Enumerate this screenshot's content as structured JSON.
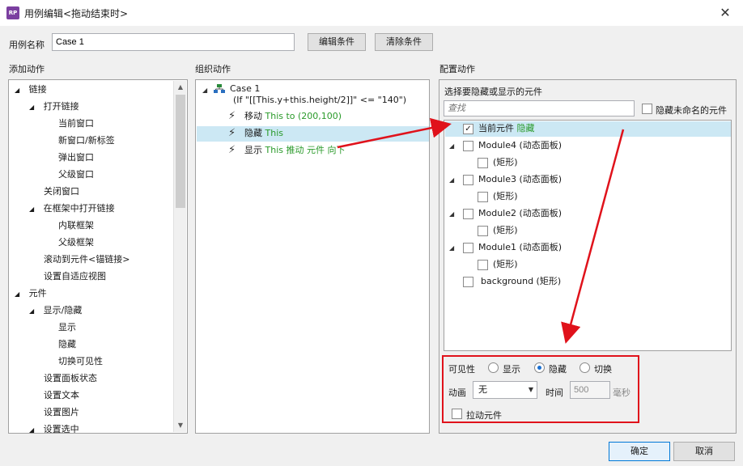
{
  "window": {
    "title": "用例编辑<拖动结束时>",
    "app_icon": "RP"
  },
  "case_name": {
    "label": "用例名称",
    "value": "Case 1",
    "edit_button": "编辑条件",
    "clear_button": "清除条件"
  },
  "add_actions": {
    "header": "添加动作",
    "items": [
      {
        "label": "链接",
        "caret": "◢"
      },
      {
        "label": "打开链接",
        "caret": "◢"
      },
      {
        "label": "当前窗口"
      },
      {
        "label": "新窗口/新标签"
      },
      {
        "label": "弹出窗口"
      },
      {
        "label": "父级窗口"
      },
      {
        "label": "关闭窗口"
      },
      {
        "label": "在框架中打开链接",
        "caret": "◢"
      },
      {
        "label": "内联框架"
      },
      {
        "label": "父级框架"
      },
      {
        "label": "滚动到元件<锚链接>"
      },
      {
        "label": "设置自适应视图"
      },
      {
        "label": "元件",
        "caret": "◢"
      },
      {
        "label": "显示/隐藏",
        "caret": "◢"
      },
      {
        "label": "显示"
      },
      {
        "label": "隐藏"
      },
      {
        "label": "切换可见性"
      },
      {
        "label": "设置面板状态"
      },
      {
        "label": "设置文本"
      },
      {
        "label": "设置图片"
      },
      {
        "label": "设置选中",
        "caret": "◢"
      }
    ]
  },
  "organize": {
    "header": "组织动作",
    "case_title": "Case 1",
    "case_condition": "(If \"[[This.y+this.height/2]]\" <= \"140\")",
    "actions": [
      {
        "verb": "移动",
        "detail": "This to (200,100)"
      },
      {
        "verb": "隐藏",
        "detail": "This"
      },
      {
        "verb": "显示",
        "detail": "This 推动 元件 向下"
      }
    ]
  },
  "configure": {
    "header": "配置动作",
    "subheader": "选择要隐藏或显示的元件",
    "search_placeholder": "查找",
    "hide_unnamed": "隐藏未命名的元件",
    "widgets": [
      {
        "label": "当前元件",
        "tag": "隐藏",
        "checked": "✓"
      },
      {
        "label": "Module4 (动态面板)",
        "caret": "◢"
      },
      {
        "label": "(矩形)"
      },
      {
        "label": "Module3 (动态面板)",
        "caret": "◢"
      },
      {
        "label": "(矩形)"
      },
      {
        "label": "Module2 (动态面板)",
        "caret": "◢"
      },
      {
        "label": "(矩形)"
      },
      {
        "label": "Module1 (动态面板)",
        "caret": "◢"
      },
      {
        "label": "(矩形)"
      },
      {
        "label": "background (矩形)"
      }
    ],
    "visibility": {
      "label": "可见性",
      "show": "显示",
      "hide": "隐藏",
      "toggle": "切换",
      "selected": "hide"
    },
    "animation": {
      "label": "动画",
      "value": "无",
      "time_label": "时间",
      "time_value": "500",
      "unit": "毫秒"
    },
    "pull_widgets": "拉动元件"
  },
  "footer": {
    "ok": "确定",
    "cancel": "取消"
  },
  "colors": {
    "annotation_red": "#e0121b",
    "selection": "#cce8f4",
    "action_green": "#2a9a2a"
  }
}
